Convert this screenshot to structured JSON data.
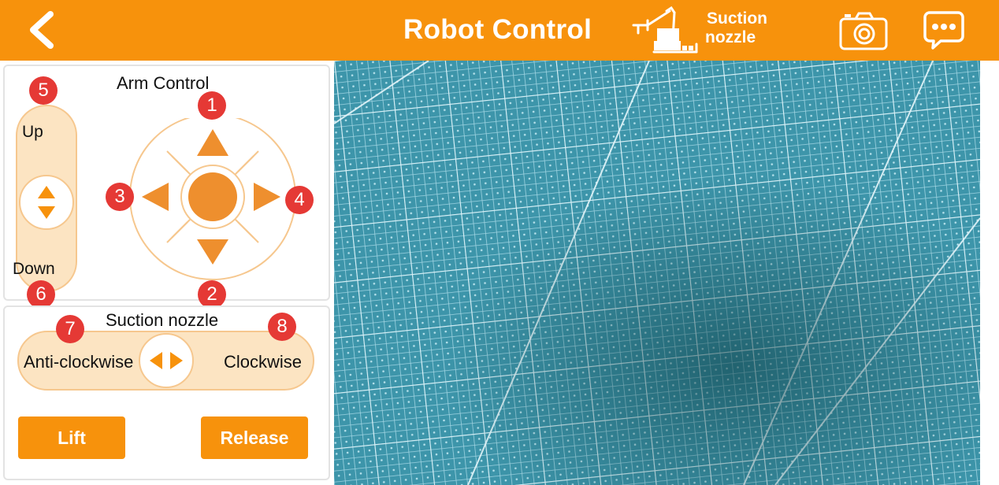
{
  "header": {
    "title": "Robot Control",
    "mode_label_line1": "Suction",
    "mode_label_line2": "nozzle",
    "back_icon": "chevron-left",
    "mode_icon": "robot-arm",
    "camera_icon": "camera",
    "message_icon": "chat-bubble"
  },
  "arm_control": {
    "title": "Arm Control",
    "up_label": "Up",
    "down_label": "Down",
    "badges": {
      "forward": "1",
      "backward": "2",
      "left": "3",
      "right": "4",
      "up": "5",
      "down": "6"
    }
  },
  "suction": {
    "title": "Suction nozzle",
    "anticlockwise_label": "Anti-clockwise",
    "clockwise_label": "Clockwise",
    "badges": {
      "anticlockwise": "7",
      "clockwise": "8"
    },
    "lift_label": "Lift",
    "release_label": "Release"
  },
  "colors": {
    "accent": "#F7920C",
    "arrow": "#EE8F2E",
    "track_fill": "#FCE4C2",
    "track_border": "#F6C78E",
    "badge": "#E53935",
    "camera_bg": "#3A8FA5"
  }
}
